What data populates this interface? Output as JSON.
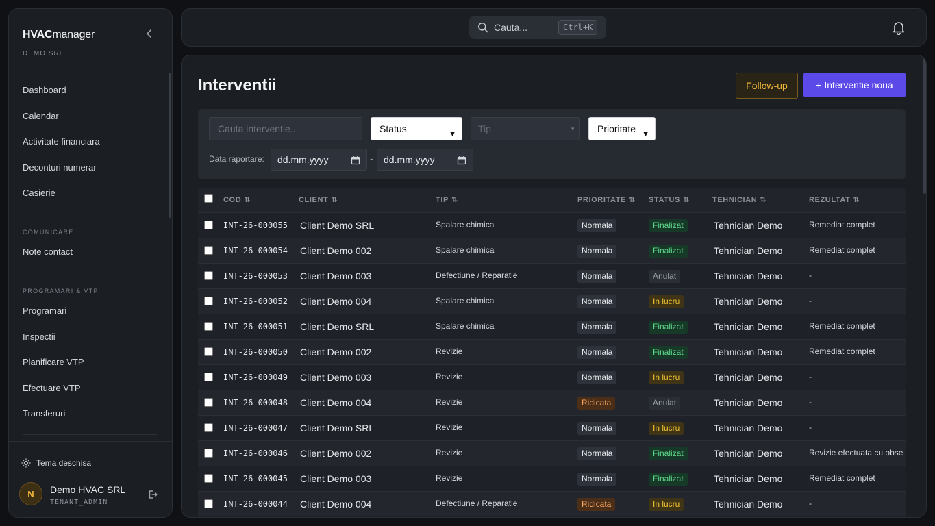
{
  "sidebar": {
    "brand_bold": "HVAC",
    "brand_light": "manager",
    "tenant": "DEMO SRL",
    "items_main": [
      "Dashboard",
      "Calendar",
      "Activitate financiara",
      "Deconturi numerar",
      "Casierie"
    ],
    "section_comunicare": "COMUNICARE",
    "items_comunicare": [
      "Note contact"
    ],
    "section_programari": "PROGRAMARI & VTP",
    "items_programari": [
      "Programari",
      "Inspectii",
      "Planificare VTP",
      "Efectuare VTP",
      "Transferuri"
    ],
    "theme_label": "Tema deschisa",
    "user": {
      "initial": "N",
      "name": "Demo HVAC SRL",
      "role": "TENANT_ADMIN"
    }
  },
  "topbar": {
    "search_placeholder": "Cauta...",
    "shortcut": "Ctrl+K"
  },
  "page": {
    "title": "Interventii",
    "btn_followup": "Follow-up",
    "btn_new": "+ Interventie noua"
  },
  "filters": {
    "search_placeholder": "Cauta interventie...",
    "status": "Status",
    "tip_placeholder": "Tip",
    "prioritate": "Prioritate",
    "date_label": "Data raportare:",
    "date_from": "dd.mm.yyyy",
    "date_sep": "-",
    "date_to": "dd.mm.yyyy"
  },
  "table": {
    "headers": {
      "cod": "COD",
      "client": "CLIENT",
      "tip": "TIP",
      "prioritate": "PRIORITATE",
      "status": "STATUS",
      "tehnician": "TEHNICIAN",
      "rezultat": "REZULTAT"
    },
    "rows": [
      {
        "cod": "INT-26-000055",
        "client": "Client Demo SRL",
        "tip": "Spalare chimica",
        "prioritate": "Normala",
        "status": "Finalizat",
        "tehnician": "Tehnician Demo",
        "rezultat": "Remediat complet"
      },
      {
        "cod": "INT-26-000054",
        "client": "Client Demo 002",
        "tip": "Spalare chimica",
        "prioritate": "Normala",
        "status": "Finalizat",
        "tehnician": "Tehnician Demo",
        "rezultat": "Remediat complet"
      },
      {
        "cod": "INT-26-000053",
        "client": "Client Demo 003",
        "tip": "Defectiune / Reparatie",
        "prioritate": "Normala",
        "status": "Anulat",
        "tehnician": "Tehnician Demo",
        "rezultat": "-"
      },
      {
        "cod": "INT-26-000052",
        "client": "Client Demo 004",
        "tip": "Spalare chimica",
        "prioritate": "Normala",
        "status": "In lucru",
        "tehnician": "Tehnician Demo",
        "rezultat": "-"
      },
      {
        "cod": "INT-26-000051",
        "client": "Client Demo SRL",
        "tip": "Spalare chimica",
        "prioritate": "Normala",
        "status": "Finalizat",
        "tehnician": "Tehnician Demo",
        "rezultat": "Remediat complet"
      },
      {
        "cod": "INT-26-000050",
        "client": "Client Demo 002",
        "tip": "Revizie",
        "prioritate": "Normala",
        "status": "Finalizat",
        "tehnician": "Tehnician Demo",
        "rezultat": "Remediat complet"
      },
      {
        "cod": "INT-26-000049",
        "client": "Client Demo 003",
        "tip": "Revizie",
        "prioritate": "Normala",
        "status": "In lucru",
        "tehnician": "Tehnician Demo",
        "rezultat": "-"
      },
      {
        "cod": "INT-26-000048",
        "client": "Client Demo 004",
        "tip": "Revizie",
        "prioritate": "Ridicata",
        "status": "Anulat",
        "tehnician": "Tehnician Demo",
        "rezultat": "-"
      },
      {
        "cod": "INT-26-000047",
        "client": "Client Demo SRL",
        "tip": "Revizie",
        "prioritate": "Normala",
        "status": "In lucru",
        "tehnician": "Tehnician Demo",
        "rezultat": "-"
      },
      {
        "cod": "INT-26-000046",
        "client": "Client Demo 002",
        "tip": "Revizie",
        "prioritate": "Normala",
        "status": "Finalizat",
        "tehnician": "Tehnician Demo",
        "rezultat": "Revizie efectuata cu obse"
      },
      {
        "cod": "INT-26-000045",
        "client": "Client Demo 003",
        "tip": "Revizie",
        "prioritate": "Normala",
        "status": "Finalizat",
        "tehnician": "Tehnician Demo",
        "rezultat": "Remediat complet"
      },
      {
        "cod": "INT-26-000044",
        "client": "Client Demo 004",
        "tip": "Defectiune / Reparatie",
        "prioritate": "Ridicata",
        "status": "In lucru",
        "tehnician": "Tehnician Demo",
        "rezultat": "-"
      }
    ]
  }
}
